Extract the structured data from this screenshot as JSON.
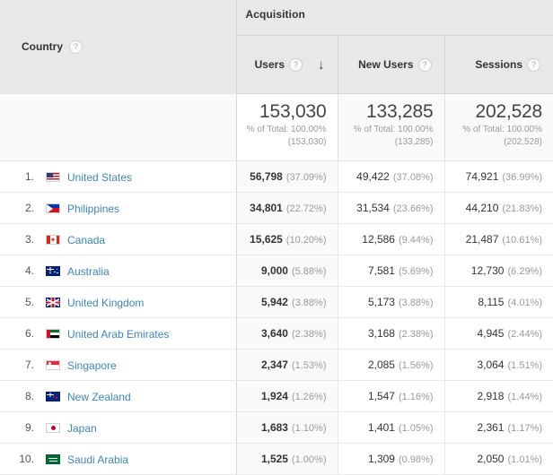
{
  "table": {
    "dimension_header": {
      "label": "Country",
      "help_icon": "?"
    },
    "group_header": {
      "label": "Acquisition"
    },
    "metric_headers": [
      {
        "label": "Users",
        "help_icon": "?",
        "sort_icon": "↓",
        "sorted": true
      },
      {
        "label": "New Users",
        "help_icon": "?",
        "sort_icon": "",
        "sorted": false
      },
      {
        "label": "Sessions",
        "help_icon": "?",
        "sort_icon": "",
        "sorted": false
      }
    ],
    "summary_row": [
      {
        "value": "153,030",
        "pct_of_total": "% of Total: 100.00%",
        "total": "(153,030)"
      },
      {
        "value": "133,285",
        "pct_of_total": "% of Total: 100.00%",
        "total": "(133,285)"
      },
      {
        "value": "202,528",
        "pct_of_total": "% of Total: 100.00%",
        "total": "(202,528)"
      }
    ],
    "rows": [
      {
        "rank": "1.",
        "country": "United States",
        "flag": "flag-united-states",
        "users": "56,798",
        "users_pct": "(37.09%)",
        "new_users": "49,422",
        "new_users_pct": "(37.08%)",
        "sessions": "74,921",
        "sessions_pct": "(36.99%)"
      },
      {
        "rank": "2.",
        "country": "Philippines",
        "flag": "flag-philippines",
        "users": "34,801",
        "users_pct": "(22.72%)",
        "new_users": "31,534",
        "new_users_pct": "(23.66%)",
        "sessions": "44,210",
        "sessions_pct": "(21.83%)"
      },
      {
        "rank": "3.",
        "country": "Canada",
        "flag": "flag-canada",
        "users": "15,625",
        "users_pct": "(10.20%)",
        "new_users": "12,586",
        "new_users_pct": "(9.44%)",
        "sessions": "21,487",
        "sessions_pct": "(10.61%)"
      },
      {
        "rank": "4.",
        "country": "Australia",
        "flag": "flag-australia",
        "users": "9,000",
        "users_pct": "(5.88%)",
        "new_users": "7,581",
        "new_users_pct": "(5.69%)",
        "sessions": "12,730",
        "sessions_pct": "(6.29%)"
      },
      {
        "rank": "5.",
        "country": "United Kingdom",
        "flag": "flag-united-kingdom",
        "users": "5,942",
        "users_pct": "(3.88%)",
        "new_users": "5,173",
        "new_users_pct": "(3.88%)",
        "sessions": "8,115",
        "sessions_pct": "(4.01%)"
      },
      {
        "rank": "6.",
        "country": "United Arab Emirates",
        "flag": "flag-united-arab-emirates",
        "users": "3,640",
        "users_pct": "(2.38%)",
        "new_users": "3,168",
        "new_users_pct": "(2.38%)",
        "sessions": "4,945",
        "sessions_pct": "(2.44%)"
      },
      {
        "rank": "7.",
        "country": "Singapore",
        "flag": "flag-singapore",
        "users": "2,347",
        "users_pct": "(1.53%)",
        "new_users": "2,085",
        "new_users_pct": "(1.56%)",
        "sessions": "3,064",
        "sessions_pct": "(1.51%)"
      },
      {
        "rank": "8.",
        "country": "New Zealand",
        "flag": "flag-new-zealand",
        "users": "1,924",
        "users_pct": "(1.26%)",
        "new_users": "1,547",
        "new_users_pct": "(1.16%)",
        "sessions": "2,918",
        "sessions_pct": "(1.44%)"
      },
      {
        "rank": "9.",
        "country": "Japan",
        "flag": "flag-japan",
        "users": "1,683",
        "users_pct": "(1.10%)",
        "new_users": "1,401",
        "new_users_pct": "(1.05%)",
        "sessions": "2,361",
        "sessions_pct": "(1.17%)"
      },
      {
        "rank": "10.",
        "country": "Saudi Arabia",
        "flag": "flag-saudi-arabia",
        "users": "1,525",
        "users_pct": "(1.00%)",
        "new_users": "1,309",
        "new_users_pct": "(0.98%)",
        "sessions": "2,050",
        "sessions_pct": "(1.01%)"
      }
    ]
  },
  "colors": {
    "link": "#4285b4",
    "header_bg": "#e8e8e8",
    "summary_bg": "#fafafa",
    "muted_text": "#9a9a9a"
  }
}
